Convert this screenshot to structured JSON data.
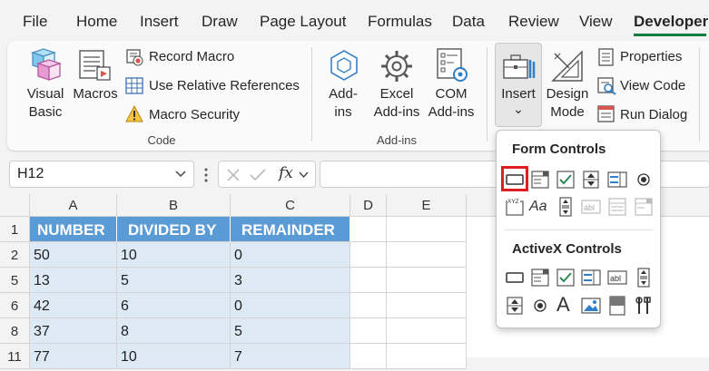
{
  "menu_tabs": [
    "File",
    "Home",
    "Insert",
    "Draw",
    "Page Layout",
    "Formulas",
    "Data",
    "Review",
    "View",
    "Developer"
  ],
  "active_tab": "Developer",
  "ribbon": {
    "code": {
      "visual_basic": "Visual Basic",
      "visual_basic_l1": "Visual",
      "visual_basic_l2": "Basic",
      "macros": "Macros",
      "record_macro": "Record Macro",
      "use_relative_references": "Use Relative References",
      "macro_security": "Macro Security",
      "group_label": "Code"
    },
    "addins": {
      "addins_l1": "Add-",
      "addins_l2": "ins",
      "excel_addins_l1": "Excel",
      "excel_addins_l2": "Add-ins",
      "com_addins_l1": "COM",
      "com_addins_l2": "Add-ins",
      "group_label": "Add-ins"
    },
    "controls": {
      "insert": "Insert",
      "insert_chevron": "⌄",
      "design_mode_l1": "Design",
      "design_mode_l2": "Mode",
      "properties": "Properties",
      "view_code": "View Code",
      "run_dialog": "Run Dialog"
    }
  },
  "formula_bar": {
    "name_box": "H12",
    "fx": "fx",
    "formula": ""
  },
  "grid": {
    "columns": [
      "A",
      "B",
      "C",
      "D",
      "E"
    ],
    "row_numbers": [
      "1",
      "2",
      "5",
      "6",
      "8",
      "11"
    ],
    "headers": [
      "NUMBER",
      "DIVIDED BY",
      "REMAINDER"
    ],
    "rows": [
      [
        "50",
        "10",
        "0"
      ],
      [
        "13",
        "5",
        "3"
      ],
      [
        "42",
        "6",
        "0"
      ],
      [
        "37",
        "8",
        "5"
      ],
      [
        "77",
        "10",
        "7"
      ]
    ]
  },
  "insert_dropdown": {
    "form_controls_label": "Form Controls",
    "activex_controls_label": "ActiveX Controls",
    "form_controls_row1": [
      "button-icon",
      "combo-box-icon",
      "checkbox-icon",
      "spin-button-icon",
      "list-box-icon",
      "option-button-icon"
    ],
    "form_controls_row2": [
      "group-box-icon",
      "label-icon",
      "scroll-bar-icon",
      "text-field-icon",
      "combo-list-edit-icon",
      "combo-drop-down-edit-icon"
    ],
    "activex_row1": [
      "command-button-icon",
      "combo-box-icon",
      "checkbox-icon",
      "list-box-icon",
      "text-box-icon",
      "scroll-bar-icon"
    ],
    "activex_row2": [
      "spin-button-icon",
      "option-button-icon",
      "label-icon",
      "image-icon",
      "toggle-button-icon",
      "more-controls-icon"
    ],
    "label_glyph": "Aa",
    "activex_label_glyph": "A",
    "group_box_glyph": "XYZ",
    "text_field_glyph": "abl",
    "highlighted": "button-icon"
  },
  "colors": {
    "header_fill": "#5b9bd5",
    "data_fill": "#dde9f5",
    "accent_green": "#107c41",
    "highlight_red": "#e02020"
  }
}
